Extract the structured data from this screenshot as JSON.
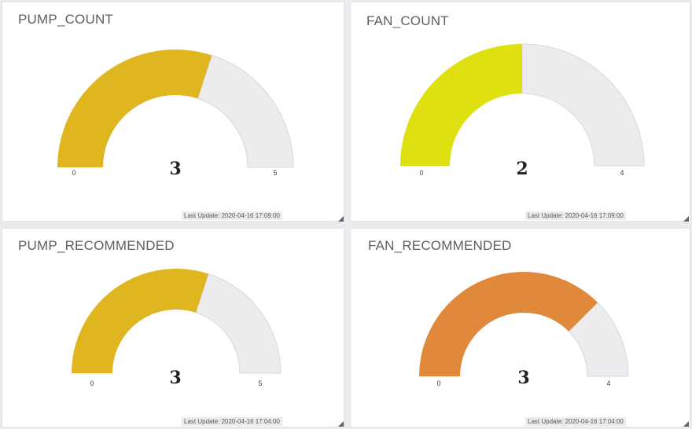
{
  "panels": [
    {
      "title": "PUMP_COUNT",
      "value": 3,
      "value_text": "3",
      "min": 0,
      "min_text": "0",
      "max": 5,
      "max_text": "5",
      "color": "#dfb520",
      "last_update": "Last Update: 2020-04-16 17:09:00"
    },
    {
      "title": "FAN_COUNT",
      "value": 2,
      "value_text": "2",
      "min": 0,
      "min_text": "0",
      "max": 4,
      "max_text": "4",
      "color": "#dfe00f",
      "last_update": "Last Update: 2020-04-16 17:09:00"
    },
    {
      "title": "PUMP_RECOMMENDED",
      "value": 3,
      "value_text": "3",
      "min": 0,
      "min_text": "0",
      "max": 5,
      "max_text": "5",
      "color": "#dfb520",
      "last_update": "Last Update: 2020-04-16 17:04:00"
    },
    {
      "title": "FAN_RECOMMENDED",
      "value": 3,
      "value_text": "3",
      "min": 0,
      "min_text": "0",
      "max": 4,
      "max_text": "4",
      "color": "#e0893a",
      "last_update": "Last Update: 2020-04-16 17:04:00"
    }
  ],
  "gauge_track_color": "#ececef",
  "resize_icon": "resize-grip-icon"
}
